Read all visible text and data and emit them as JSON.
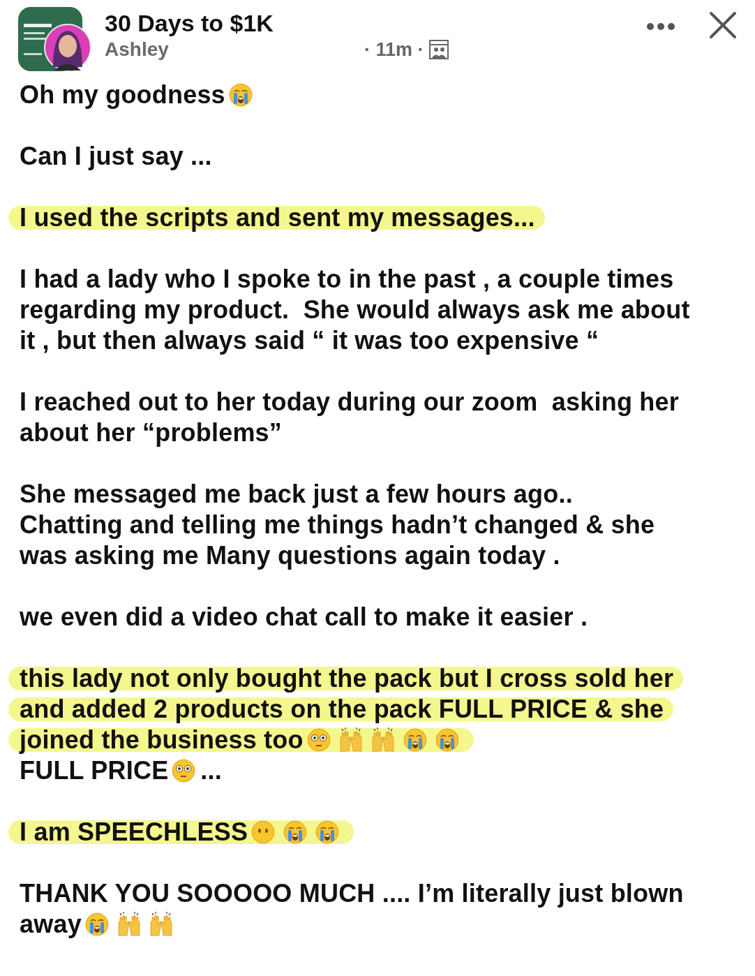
{
  "header": {
    "group_name": "30 Days to $1K",
    "author": "Ashley",
    "time": "· 11m ·"
  },
  "paragraphs": [
    {
      "lines": [
        {
          "highlighted": false,
          "parts": [
            {
              "kind": "text",
              "text": "Oh my goodness"
            },
            {
              "kind": "crying-face"
            }
          ]
        }
      ]
    },
    {
      "lines": [
        {
          "highlighted": false,
          "parts": [
            {
              "kind": "text",
              "text": "Can I just say ..."
            }
          ]
        }
      ]
    },
    {
      "lines": [
        {
          "highlighted": true,
          "parts": [
            {
              "kind": "text",
              "text": "I used the scripts and sent my messages..."
            }
          ]
        }
      ]
    },
    {
      "lines": [
        {
          "highlighted": false,
          "parts": [
            {
              "kind": "text",
              "text": "I had a lady who I spoke to in the past , a couple times"
            }
          ]
        },
        {
          "highlighted": false,
          "parts": [
            {
              "kind": "text",
              "text": "regarding my product.  She would always ask me about"
            }
          ]
        },
        {
          "highlighted": false,
          "parts": [
            {
              "kind": "text",
              "text": "it , but then always said “ it was too expensive “"
            }
          ]
        }
      ]
    },
    {
      "lines": [
        {
          "highlighted": false,
          "parts": [
            {
              "kind": "text",
              "text": "I reached out to her today during our zoom  asking her"
            }
          ]
        },
        {
          "highlighted": false,
          "parts": [
            {
              "kind": "text",
              "text": "about her “problems”"
            }
          ]
        }
      ]
    },
    {
      "lines": [
        {
          "highlighted": false,
          "parts": [
            {
              "kind": "text",
              "text": "She messaged me back just a few hours ago.."
            }
          ]
        },
        {
          "highlighted": false,
          "parts": [
            {
              "kind": "text",
              "text": "Chatting and telling me things hadn’t changed & she"
            }
          ]
        },
        {
          "highlighted": false,
          "parts": [
            {
              "kind": "text",
              "text": "was asking me Many questions again today ."
            }
          ]
        }
      ]
    },
    {
      "lines": [
        {
          "highlighted": false,
          "parts": [
            {
              "kind": "text",
              "text": "we even did a video chat call to make it easier ."
            }
          ]
        }
      ]
    },
    {
      "lines": [
        {
          "highlighted": true,
          "parts": [
            {
              "kind": "text",
              "text": "this lady not only bought the pack but I cross sold her"
            }
          ]
        },
        {
          "highlighted": true,
          "parts": [
            {
              "kind": "text",
              "text": "and added 2 products on the pack FULL PRICE & she"
            }
          ]
        },
        {
          "highlighted": true,
          "parts": [
            {
              "kind": "text",
              "text": "joined the business too"
            },
            {
              "kind": "flushed-face"
            },
            {
              "kind": "raised-hands"
            },
            {
              "kind": "raised-hands"
            },
            {
              "kind": "crying-face"
            },
            {
              "kind": "crying-face"
            }
          ]
        },
        {
          "highlighted": false,
          "parts": [
            {
              "kind": "text",
              "text": "FULL PRICE"
            },
            {
              "kind": "flushed-face"
            },
            {
              "kind": "text",
              "text": "..."
            }
          ]
        }
      ]
    },
    {
      "lines": [
        {
          "highlighted": true,
          "parts": [
            {
              "kind": "text",
              "text": "I am SPEECHLESS"
            },
            {
              "kind": "no-mouth-face"
            },
            {
              "kind": "crying-face"
            },
            {
              "kind": "crying-face"
            }
          ]
        }
      ]
    },
    {
      "lines": [
        {
          "highlighted": false,
          "parts": [
            {
              "kind": "text",
              "text": "THANK YOU SOOOOO MUCH .... I’m literally just blown"
            }
          ]
        },
        {
          "highlighted": false,
          "parts": [
            {
              "kind": "text",
              "text": "away"
            },
            {
              "kind": "crying-face"
            },
            {
              "kind": "raised-hands"
            },
            {
              "kind": "raised-hands"
            }
          ]
        }
      ]
    }
  ]
}
